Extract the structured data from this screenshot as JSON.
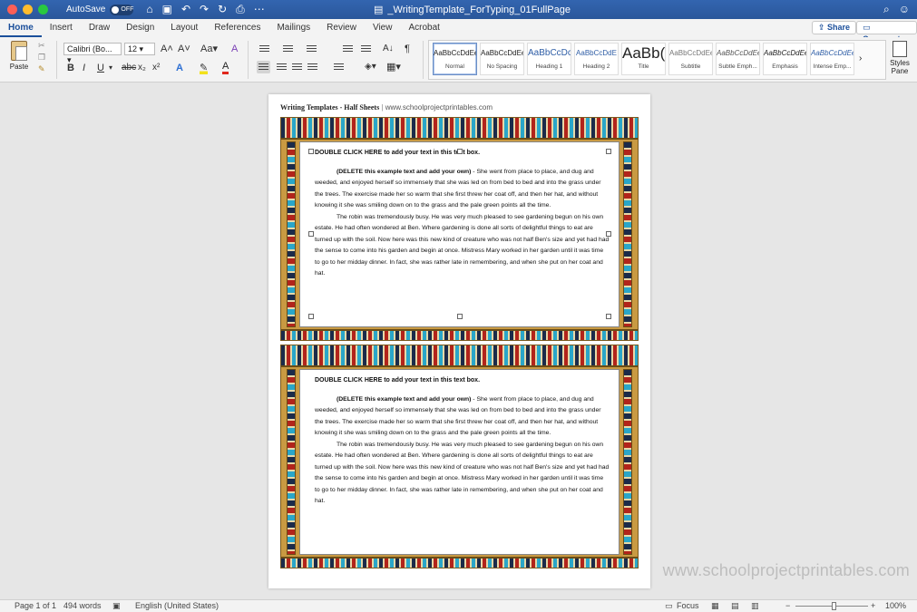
{
  "window": {
    "autosave_label": "AutoSave",
    "autosave_state": "OFF",
    "doc_title": "_WritingTemplate_ForTyping_01FullPage"
  },
  "tabs": [
    "Home",
    "Insert",
    "Draw",
    "Design",
    "Layout",
    "References",
    "Mailings",
    "Review",
    "View",
    "Acrobat"
  ],
  "share_label": "Share",
  "comments_label": "Comments",
  "ribbon": {
    "paste_label": "Paste",
    "font_name": "Calibri (Bo...",
    "font_size": "12",
    "styles": [
      {
        "sample": "AaBbCcDdEe",
        "name": "Normal"
      },
      {
        "sample": "AaBbCcDdEe",
        "name": "No Spacing"
      },
      {
        "sample": "AaBbCcDc",
        "name": "Heading 1"
      },
      {
        "sample": "AaBbCcDdE",
        "name": "Heading 2"
      },
      {
        "sample": "AaBb(",
        "name": "Title"
      },
      {
        "sample": "AaBbCcDdEe",
        "name": "Subtitle"
      },
      {
        "sample": "AaBbCcDdEe",
        "name": "Subtle Emph..."
      },
      {
        "sample": "AaBbCcDdEe",
        "name": "Emphasis"
      },
      {
        "sample": "AaBbCcDdEe",
        "name": "Intense Emp..."
      }
    ],
    "styles_pane_label": "Styles Pane"
  },
  "document": {
    "header_title": "Writing Templates - Half Sheets",
    "header_sep": "|",
    "header_url": "www.schoolprojectprintables.com",
    "boxes": [
      {
        "heading": "DOUBLE CLICK HERE to add your text in this text box.",
        "lead": "(DELETE this example text and add your own)",
        "p1": " - She went from place to place, and dug and weeded, and enjoyed herself so immensely that she was led on from bed to bed and into the grass under the trees. The exercise made her so warm that she first threw her coat off, and then her hat, and without knowing it she was smiling down on to the grass and the pale green points all the time.",
        "p2": "The robin was tremendously busy. He was very much pleased to see gardening begun on his own estate. He had often wondered at Ben. Where gardening is done all sorts of delightful things to eat are turned up with the soil. Now here was this new kind of creature who was not half Ben's size and yet had had the sense to come into his garden and begin at once. Mistress Mary worked in her garden until it was time to go to her midday dinner. In fact, she was rather late in remembering, and when she put on her coat and hat."
      },
      {
        "heading": "DOUBLE CLICK HERE to add your text in this text box.",
        "lead": "(DELETE this example text and add your own)",
        "p1": " - She went from place to place, and dug and weeded, and enjoyed herself so immensely that she was led on from bed to bed and into the grass under the trees. The exercise made her so warm that she first threw her coat off, and then her hat, and without knowing it she was smiling down on to the grass and the pale green points all the time.",
        "p2": "The robin was tremendously busy. He was very much pleased to see gardening begun on his own estate. He had often wondered at Ben. Where gardening is done all sorts of delightful things to eat are turned up with the soil. Now here was this new kind of creature who was not half Ben's size and yet had had the sense to come into his garden and begin at once. Mistress Mary worked in her garden until it was time to go to her midday dinner. In fact, she was rather late in remembering, and when she put on her coat and hat."
      }
    ]
  },
  "watermark": "www.schoolprojectprintables.com",
  "status": {
    "page": "Page 1 of 1",
    "words": "494 words",
    "language": "English (United States)",
    "focus": "Focus",
    "zoom_minus": "−",
    "zoom_plus": "+",
    "zoom": "100%"
  }
}
